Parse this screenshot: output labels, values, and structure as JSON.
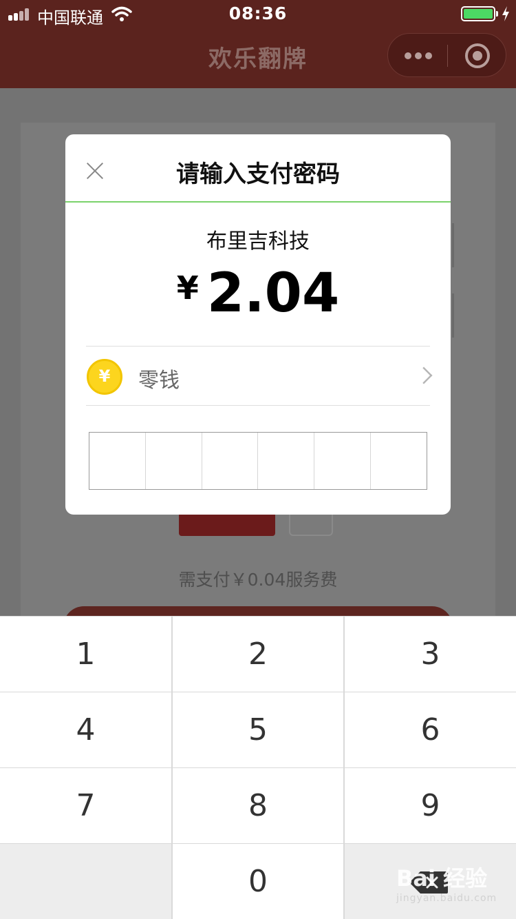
{
  "status_bar": {
    "carrier": "中国联通",
    "time": "08:36"
  },
  "nav": {
    "title": "欢乐翻牌"
  },
  "background_page": {
    "fee_text": "需支付￥0.04服务费"
  },
  "dialog": {
    "title": "请输入支付密码",
    "merchant": "布里吉科技",
    "currency_symbol": "¥",
    "amount": "2.04",
    "payment_method": "零钱",
    "coin_symbol": "¥",
    "pin_length": 6
  },
  "keypad": {
    "keys": [
      "1",
      "2",
      "3",
      "4",
      "5",
      "6",
      "7",
      "8",
      "9",
      "",
      "0",
      "delete"
    ]
  },
  "watermark": {
    "text": "Bai 经验",
    "sub": "jingyan.baidu.com"
  },
  "colors": {
    "nav_bg": "#5b231e",
    "accent_line": "#7ad26a",
    "coin": "#fcd51e",
    "battery": "#4cd964"
  }
}
